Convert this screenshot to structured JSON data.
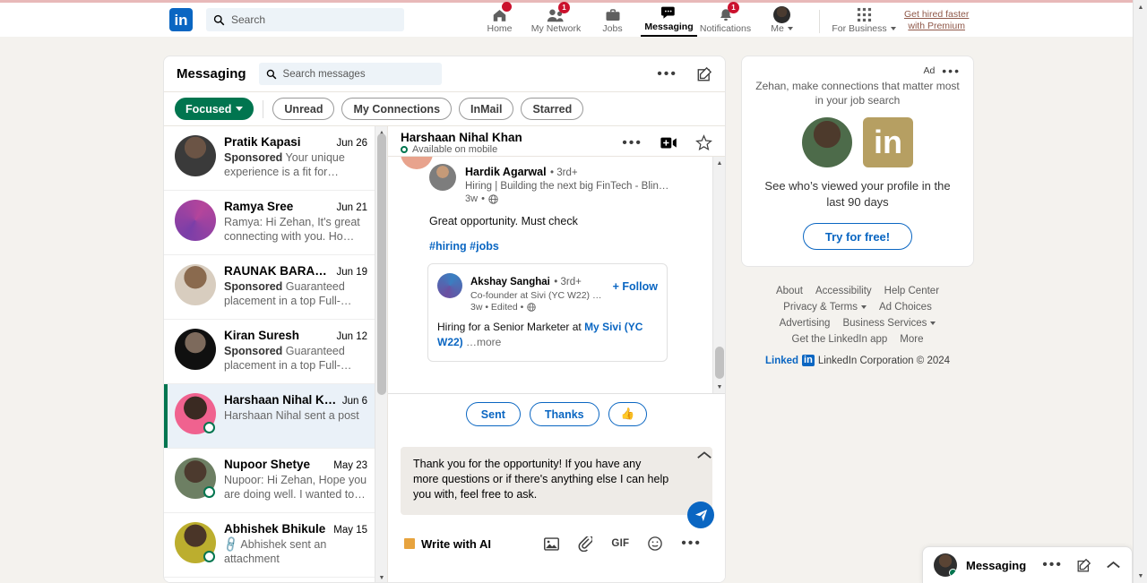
{
  "nav": {
    "logo": "in",
    "search_placeholder": "Search",
    "items": [
      {
        "label": "Home",
        "icon": "home-icon",
        "badge": "",
        "active": false
      },
      {
        "label": "My Network",
        "icon": "network-icon",
        "badge": "1",
        "active": false
      },
      {
        "label": "Jobs",
        "icon": "jobs-icon",
        "badge": "",
        "active": false
      },
      {
        "label": "Messaging",
        "icon": "messaging-icon",
        "badge": "",
        "active": true
      },
      {
        "label": "Notifications",
        "icon": "bell-icon",
        "badge": "1",
        "active": false
      },
      {
        "label": "Me",
        "icon": "avatar-icon",
        "badge": "",
        "active": false
      }
    ],
    "for_business": "For Business",
    "premium_line1": "Get hired faster",
    "premium_line2": "with Premium"
  },
  "messaging": {
    "title": "Messaging",
    "search_placeholder": "Search messages",
    "filters": [
      {
        "label": "Focused",
        "selected": true
      },
      {
        "label": "Unread",
        "selected": false
      },
      {
        "label": "My Connections",
        "selected": false
      },
      {
        "label": "InMail",
        "selected": false
      },
      {
        "label": "Starred",
        "selected": false
      }
    ],
    "conversations": [
      {
        "name": "Pratik Kapasi",
        "date": "Jun 26",
        "tag": "Sponsored",
        "snippet": "Your unique experience is a fit for…",
        "selected": false,
        "presence": false,
        "attachment": false
      },
      {
        "name": "Ramya Sree",
        "date": "Jun 21",
        "tag": "",
        "snippet": "Ramya: Hi Zehan, It's great connecting with you. Ho…",
        "selected": false,
        "presence": false,
        "attachment": false
      },
      {
        "name": "RAUNAK BARANWAL",
        "date": "Jun 19",
        "tag": "Sponsored",
        "snippet": "Guaranteed placement in a top Full-…",
        "selected": false,
        "presence": false,
        "attachment": false
      },
      {
        "name": "Kiran Suresh",
        "date": "Jun 12",
        "tag": "Sponsored",
        "snippet": "Guaranteed placement in a top Full-…",
        "selected": false,
        "presence": false,
        "attachment": false
      },
      {
        "name": "Harshaan Nihal Khan",
        "date": "Jun 6",
        "tag": "",
        "snippet": "Harshaan Nihal sent a post",
        "selected": true,
        "presence": true,
        "attachment": false
      },
      {
        "name": "Nupoor Shetye",
        "date": "May 23",
        "tag": "",
        "snippet": "Nupoor: Hi Zehan, Hope you are doing well. I wanted to…",
        "selected": false,
        "presence": true,
        "attachment": false
      },
      {
        "name": "Abhishek Bhikule",
        "date": "May 15",
        "tag": "",
        "snippet": "Abhishek sent an attachment",
        "selected": false,
        "presence": true,
        "attachment": true
      }
    ]
  },
  "thread": {
    "name": "Harshaan Nihal Khan",
    "status": "Available on mobile",
    "post": {
      "author": "Hardik Agarwal",
      "degree": "• 3rd+",
      "headline": "Hiring | Building the next big FinTech - Blin…",
      "time": "3w",
      "visibility": "globe-icon",
      "text": "Great opportunity. Must check",
      "tags": "#hiring #jobs"
    },
    "shared_post": {
      "author": "Akshay Sanghai",
      "degree": "• 3rd+",
      "headline": "Co-founder at Sivi (YC W22) …",
      "time": "3w • Edited •",
      "follow": "+ Follow",
      "body_pre": "Hiring for a Senior Marketer at ",
      "body_link": "My Sivi (YC W22)",
      "body_more": "…more"
    },
    "quick_replies": [
      {
        "label": "Sent"
      },
      {
        "label": "Thanks"
      },
      {
        "label": "👍"
      }
    ],
    "draft": "Thank you for the opportunity! If you have any more questions or if there's anything else I can help you with, feel free to ask.",
    "write_with_ai": "Write with AI",
    "tools": [
      "image-icon",
      "attachment-icon",
      "GIF",
      "emoji-icon",
      "more-icon"
    ],
    "gif_label": "GIF"
  },
  "rail": {
    "ad": {
      "ad_label": "Ad",
      "headline": "Zehan, make connections that matter most in your job search",
      "brand_glyph": "in",
      "subhead": "See who’s viewed your profile in the last 90 days",
      "cta": "Try for free!"
    },
    "footer": {
      "row1": [
        "About",
        "Accessibility",
        "Help Center"
      ],
      "row2": [
        "Privacy & Terms",
        "Ad Choices"
      ],
      "row3": [
        "Advertising",
        "Business Services"
      ],
      "row4": [
        "Get the LinkedIn app",
        "More"
      ],
      "brand_word": "Linked",
      "brand_badge": "in",
      "copyright": "LinkedIn Corporation © 2024"
    }
  },
  "overlay": {
    "title": "Messaging"
  }
}
